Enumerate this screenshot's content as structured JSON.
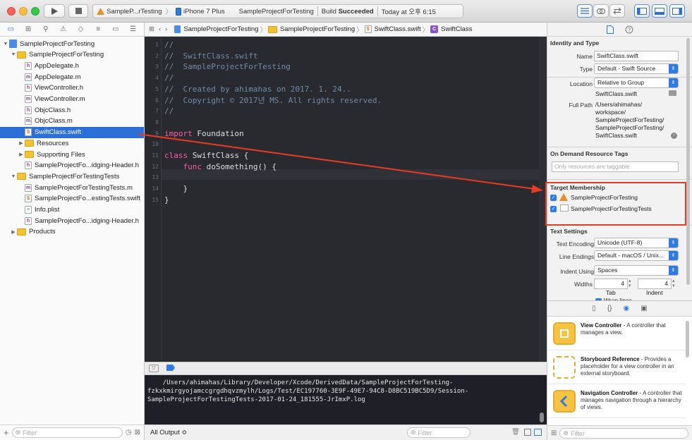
{
  "toolbar": {
    "scheme": "SampleP...rTesting",
    "device": "iPhone 7 Plus",
    "project": "SampleProjectForTesting",
    "status_prefix": "Build",
    "status": "Succeeded",
    "timestamp": "Today at 오후 6:15"
  },
  "navigator": {
    "rows": [
      {
        "label": "SampleProjectForTesting",
        "kind": "project",
        "disc": "▼"
      },
      {
        "label": "SampleProjectForTesting",
        "kind": "folder",
        "disc": "▼"
      },
      {
        "label": "AppDelegate.h",
        "kind": "h"
      },
      {
        "label": "AppDelegate.m",
        "kind": "m"
      },
      {
        "label": "ViewController.h",
        "kind": "h"
      },
      {
        "label": "ViewController.m",
        "kind": "m"
      },
      {
        "label": "ObjcClass.h",
        "kind": "h"
      },
      {
        "label": "ObjcClass.m",
        "kind": "m"
      },
      {
        "label": "SwiftClass.swift",
        "kind": "swift"
      },
      {
        "label": "Resources",
        "kind": "folder",
        "disc": "▶"
      },
      {
        "label": "Supporting Files",
        "kind": "folder",
        "disc": "▶"
      },
      {
        "label": "SampleProjectFo...idging-Header.h",
        "kind": "h"
      },
      {
        "label": "SampleProjectForTestingTests",
        "kind": "folder",
        "disc": "▼"
      },
      {
        "label": "SampleProjectForTestingTests.m",
        "kind": "m"
      },
      {
        "label": "SampleProjectFo...estingTests.swift",
        "kind": "swift"
      },
      {
        "label": "Info.plist",
        "kind": "plist"
      },
      {
        "label": "SampleProjectFo...idging-Header.h",
        "kind": "h"
      },
      {
        "label": "Products",
        "kind": "folder",
        "disc": "▶"
      }
    ],
    "filter_placeholder": "Filter"
  },
  "jumpbar": {
    "crumbs": [
      "SampleProjectForTesting",
      "SampleProjectForTesting",
      "SwiftClass.swift",
      "SwiftClass"
    ]
  },
  "code": {
    "line_numbers": [
      "1",
      "2",
      "3",
      "4",
      "5",
      "6",
      "7",
      "8",
      "9",
      "10",
      "11",
      "12",
      "13",
      "14",
      "15"
    ],
    "lines": [
      [
        {
          "t": "//",
          "c": "cm"
        }
      ],
      [
        {
          "t": "//  SwiftClass.swift",
          "c": "cm"
        }
      ],
      [
        {
          "t": "//  SampleProjectForTesting",
          "c": "cm"
        }
      ],
      [
        {
          "t": "//",
          "c": "cm"
        }
      ],
      [
        {
          "t": "//  Created by ahimahas on 2017. 1. 24..",
          "c": "cm"
        }
      ],
      [
        {
          "t": "//  Copyright © 2017년 MS. All rights reserved.",
          "c": "cm"
        }
      ],
      [
        {
          "t": "//",
          "c": "cm"
        }
      ],
      [],
      [
        {
          "t": "import",
          "c": "kw"
        },
        {
          "t": " Foundation",
          "c": ""
        }
      ],
      [],
      [
        {
          "t": "class",
          "c": "kw"
        },
        {
          "t": " SwiftClass {",
          "c": ""
        }
      ],
      [
        {
          "t": "    func",
          "c": "kw"
        },
        {
          "t": " doSomething() {",
          "c": ""
        }
      ],
      [],
      [
        {
          "t": "    }",
          "c": ""
        }
      ],
      [
        {
          "t": "}",
          "c": ""
        }
      ]
    ]
  },
  "console": {
    "text": "    /Users/ahimahas/Library/Developer/Xcode/DerivedData/SampleProjectForTesting-\nfzkxkmirgyojamccgrgdhqvzmylh/Logs/Test/EC197760-3E9F-49E7-94C8-D8BC519BC5D9/Session-\nSampleProjectForTestingTests-2017-01-24_181555-JrImxP.log",
    "output_selector": "All Output ≎",
    "filter_placeholder": "Filter"
  },
  "inspector": {
    "identity_title": "Identity and Type",
    "name_label": "Name",
    "name_value": "SwiftClass.swift",
    "type_label": "Type",
    "type_value": "Default - Swift Source",
    "location_label": "Location",
    "location_value": "Relative to Group",
    "location_file": "SwiftClass.swift",
    "fullpath_label": "Full Path",
    "fullpath_value": "/Users/ahimahas/\nworkspace/\nSampleProjectForTesting/\nSampleProjectForTesting/\nSwiftClass.swift",
    "odr_title": "On Demand Resource Tags",
    "odr_placeholder": "Only resources are taggable",
    "membership_title": "Target Membership",
    "targets": [
      "SampleProjectForTesting",
      "SampleProjectForTestingTests"
    ],
    "text_settings_title": "Text Settings",
    "encoding_label": "Text Encoding",
    "encoding_value": "Unicode (UTF-8)",
    "endings_label": "Line Endings",
    "endings_value": "Default - macOS / Unix...",
    "indent_label": "Indent Using",
    "indent_value": "Spaces",
    "widths_label": "Widths",
    "tab_width": "4",
    "indent_width": "4",
    "tab_label": "Tab",
    "indent_sublabel": "Indent",
    "wrap_label": "Wrap lines"
  },
  "library": {
    "items": [
      {
        "name": "View Controller",
        "desc": " - A controller that manages a view."
      },
      {
        "name": "Storyboard Reference",
        "desc": " - Provides a placeholder for a view controller in an external storyboard."
      },
      {
        "name": "Navigation Controller",
        "desc": " - A controller that manages navigation through a hierarchy of views."
      }
    ],
    "filter_placeholder": "Filter"
  },
  "colors": {
    "selection": "#2c6fd6",
    "annotation": "#e53b23",
    "accent": "#2f7ae5"
  }
}
